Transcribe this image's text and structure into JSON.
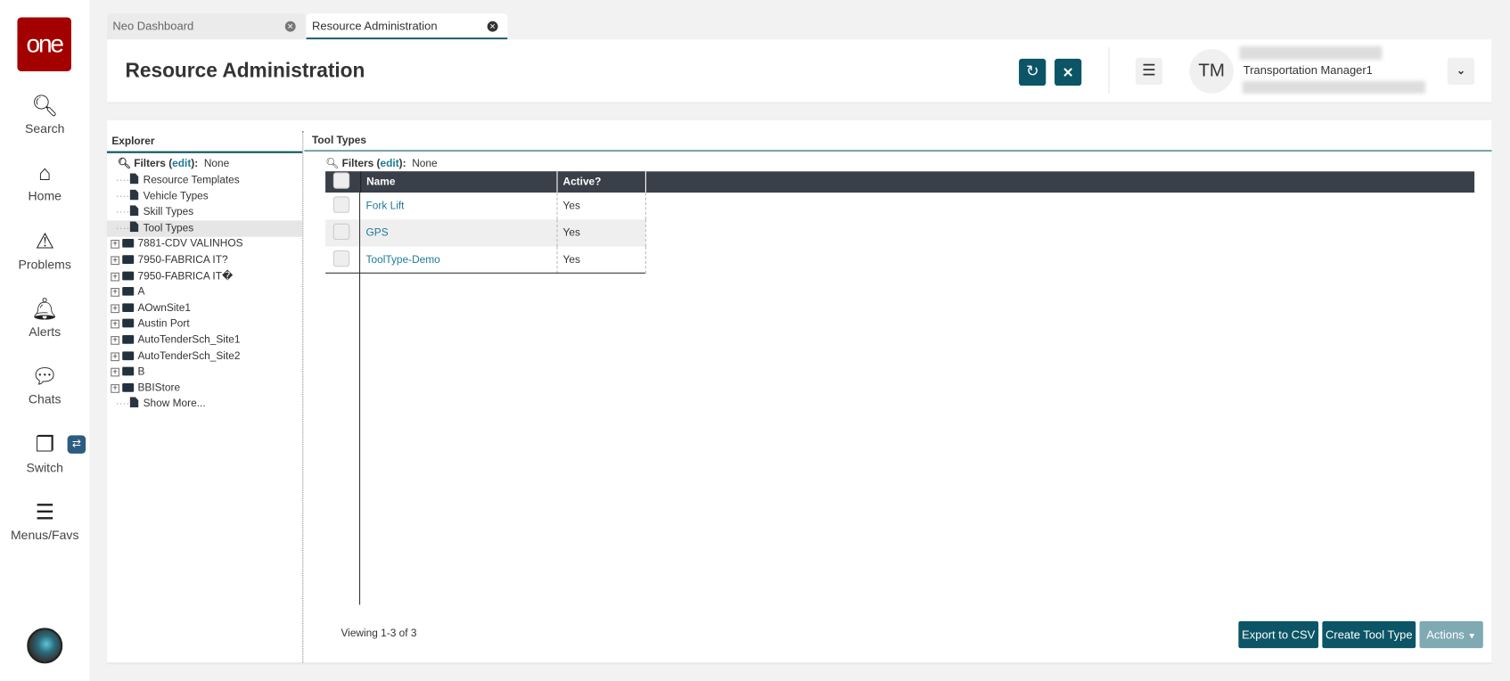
{
  "sidebar": {
    "logo": "one",
    "items": [
      {
        "label": "Search",
        "icon": "search-icon"
      },
      {
        "label": "Home",
        "icon": "home-icon"
      },
      {
        "label": "Problems",
        "icon": "warning-icon"
      },
      {
        "label": "Alerts",
        "icon": "bell-icon"
      },
      {
        "label": "Chats",
        "icon": "chat-icon"
      },
      {
        "label": "Switch",
        "icon": "switch-icon"
      },
      {
        "label": "Menus/Favs",
        "icon": "menu-icon"
      }
    ]
  },
  "tabs": [
    {
      "label": "Neo Dashboard",
      "active": false
    },
    {
      "label": "Resource Administration",
      "active": true
    }
  ],
  "header": {
    "title": "Resource Administration",
    "user_initials": "TM",
    "user_role": "Transportation Manager1"
  },
  "explorer": {
    "title": "Explorer",
    "filters_label": "Filters",
    "filters_edit": "edit",
    "filters_value": "None",
    "docs": [
      "Resource Templates",
      "Vehicle Types",
      "Skill Types",
      "Tool Types"
    ],
    "selected": "Tool Types",
    "folders": [
      "7881-CDV VALINHOS",
      "7950-FABRICA IT?",
      "7950-FABRICA IT�",
      "A",
      "AOwnSite1",
      "Austin Port",
      "AutoTenderSch_Site1",
      "AutoTenderSch_Site2",
      "B",
      "BBIStore"
    ],
    "show_more": "Show More..."
  },
  "main": {
    "title": "Tool Types",
    "filters_label": "Filters",
    "filters_edit": "edit",
    "filters_value": "None",
    "columns": [
      "Name",
      "Active?"
    ],
    "rows": [
      {
        "name": "Fork Lift",
        "active": "Yes"
      },
      {
        "name": "GPS",
        "active": "Yes"
      },
      {
        "name": "ToolType-Demo",
        "active": "Yes"
      }
    ],
    "viewing": "Viewing 1-3 of 3",
    "buttons": {
      "export": "Export to CSV",
      "create": "Create Tool Type",
      "actions": "Actions"
    }
  },
  "colors": {
    "accent": "#0b5566",
    "logo": "#a30000",
    "table_header": "#3a4049"
  }
}
